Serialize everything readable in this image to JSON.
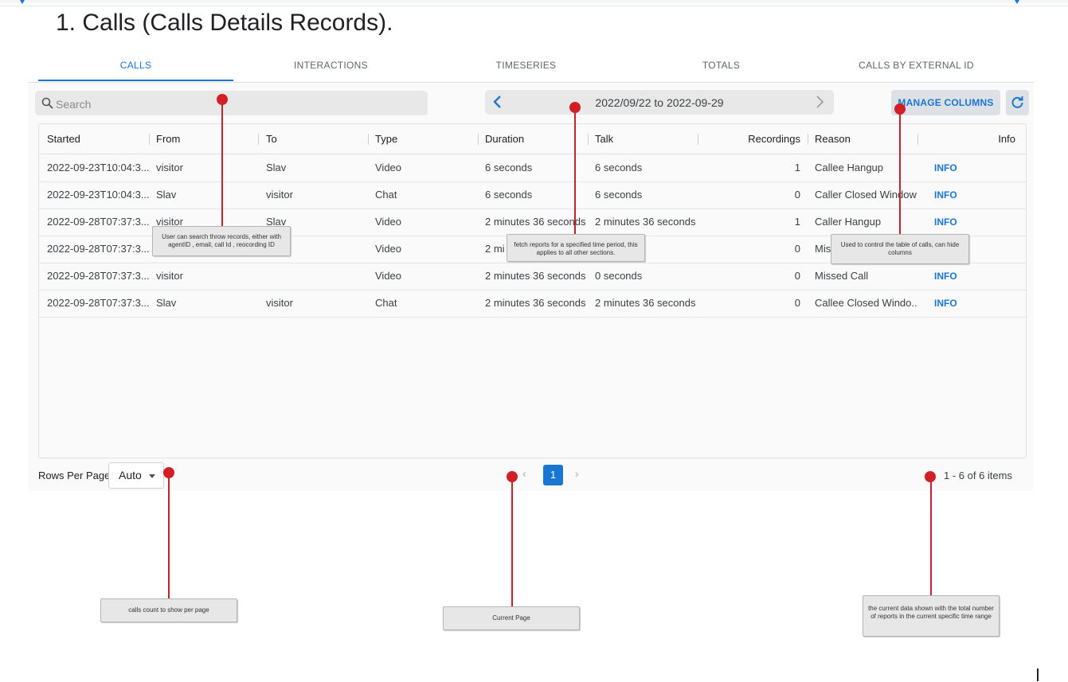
{
  "document": {
    "title": "1. Calls (Calls Details Records)."
  },
  "tabs": [
    {
      "label": "CALLS",
      "active": true
    },
    {
      "label": "INTERACTIONS",
      "active": false
    },
    {
      "label": "TIMESERIES",
      "active": false
    },
    {
      "label": "TOTALS",
      "active": false
    },
    {
      "label": "CALLS BY EXTERNAL ID",
      "active": false
    }
  ],
  "toolbar": {
    "search_placeholder": "Search",
    "search_icon": "search-icon",
    "date_range": "2022/09/22 to 2022-09-29",
    "prev_icon": "chevron-left-icon",
    "next_icon": "chevron-right-icon",
    "manage_columns_label": "MANAGE COLUMNS",
    "refresh_icon": "refresh-icon"
  },
  "table": {
    "columns": [
      "Started",
      "From",
      "To",
      "Type",
      "Duration",
      "Talk",
      "Recordings",
      "Reason",
      "Info"
    ],
    "rows": [
      {
        "started": "2022-09-23T10:04:3...",
        "from": "visitor",
        "to": "Slav",
        "type": "Video",
        "duration": "6 seconds",
        "talk": "6 seconds",
        "recordings": "1",
        "reason": "Callee Hangup",
        "info": "INFO"
      },
      {
        "started": "2022-09-23T10:04:3...",
        "from": "Slav",
        "to": "visitor",
        "type": "Chat",
        "duration": "6 seconds",
        "talk": "6 seconds",
        "recordings": "0",
        "reason": "Caller Closed Window",
        "info": "INFO"
      },
      {
        "started": "2022-09-28T07:37:3...",
        "from": "visitor",
        "to": "Slav",
        "type": "Video",
        "duration": "2 minutes 36 seconds",
        "talk": "2 minutes 36 seconds",
        "recordings": "1",
        "reason": "Caller Hangup",
        "info": "INFO"
      },
      {
        "started": "2022-09-28T07:37:3...",
        "from": "",
        "to": "",
        "type": "Video",
        "duration": "2 mi",
        "talk": "",
        "recordings": "0",
        "reason": "Mis",
        "info": ""
      },
      {
        "started": "2022-09-28T07:37:3...",
        "from": "visitor",
        "to": "",
        "type": "Video",
        "duration": "2 minutes 36 seconds",
        "talk": "0 seconds",
        "recordings": "0",
        "reason": "Missed Call",
        "info": "INFO"
      },
      {
        "started": "2022-09-28T07:37:3...",
        "from": "Slav",
        "to": "visitor",
        "type": "Chat",
        "duration": "2 minutes 36 seconds",
        "talk": "2 minutes 36 seconds",
        "recordings": "0",
        "reason": "Callee Closed Windo...",
        "info": "INFO"
      }
    ]
  },
  "footer": {
    "rows_per_page_label": "Rows Per Page",
    "rows_per_page_value": "Auto",
    "current_page": "1",
    "prev_symbol": "‹",
    "next_symbol": "›",
    "items_summary": "1 - 6 of 6 items"
  },
  "annotations": {
    "search": "User can search throw records, either with agentID , email, call Id , reocording ID",
    "date": "fetch reports for a specified time period, this applies to all other sections.",
    "columns": "Used to control the table of calls, can hide columns",
    "rows_per_page": "calls count to show per page",
    "current_page": "Current Page",
    "items": "the current data shown with the total number of reports in the current specific time range"
  },
  "colors": {
    "accent": "#1976d2",
    "annotation_red": "#d21f26"
  }
}
